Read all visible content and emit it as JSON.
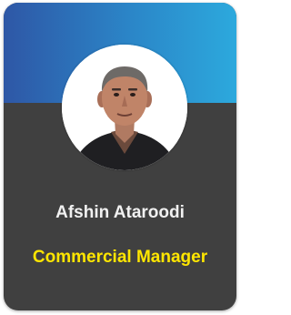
{
  "profile_card": {
    "name": "Afshin Ataroodi",
    "title": "Commercial Manager",
    "photo_icon": "person-portrait"
  },
  "colors": {
    "banner_start": "#2e57a6",
    "banner_end": "#2ca9dd",
    "card_background": "#404040",
    "name_text": "#f1f1f1",
    "title_text": "#ffe600"
  }
}
